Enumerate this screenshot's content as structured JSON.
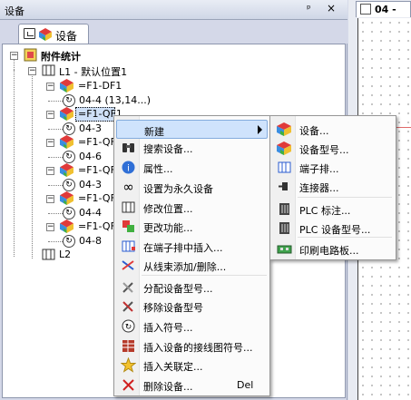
{
  "panel": {
    "title": "设备",
    "pin": "ᵖ",
    "close": "×"
  },
  "tab": {
    "label": "设备"
  },
  "doc_tab": {
    "label": "04 -"
  },
  "tree": {
    "root": "附件统计",
    "location": "L1 - 默认位置1",
    "items": [
      {
        "device": "=F1-DF1",
        "child": "04-4 (13,14...)"
      },
      {
        "device": "=F1-QF1",
        "child": "04-3"
      },
      {
        "device": "=F1-QF2",
        "child": "04-6"
      },
      {
        "device": "=F1-QF3",
        "child": "04-3"
      },
      {
        "device": "=F1-QF4",
        "child": "04-4"
      },
      {
        "device": "=F1-QF5",
        "child": "04-8"
      }
    ],
    "location2": "L2"
  },
  "context_menu": {
    "items": [
      {
        "label": "新建",
        "icon": "blank",
        "submenu": true
      },
      {
        "label": "搜索设备...",
        "icon": "binoculars-icon"
      },
      {
        "label": "属性...",
        "icon": "info-icon"
      },
      {
        "label": "设置为永久设备",
        "icon": "infinity-icon"
      },
      {
        "label": "修改位置...",
        "icon": "location-icon"
      },
      {
        "label": "更改功能...",
        "icon": "function-icon"
      },
      {
        "label": "在端子排中插入...",
        "icon": "terminal-insert-icon"
      },
      {
        "label": "从线束添加/删除...",
        "icon": "harness-icon"
      },
      {
        "label": "分配设备型号...",
        "icon": "assign-tools-icon"
      },
      {
        "label": "移除设备型号",
        "icon": "remove-tools-icon"
      },
      {
        "label": "插入符号...",
        "icon": "symbol-icon"
      },
      {
        "label": "插入设备的接线图符号...",
        "icon": "wiring-icon"
      },
      {
        "label": "插入关联定...",
        "icon": "star-icon"
      },
      {
        "label": "删除设备...",
        "icon": "delete-icon",
        "shortcut": "Del"
      }
    ]
  },
  "submenu": {
    "items": [
      {
        "label": "设备...",
        "icon": "device-cube-icon"
      },
      {
        "label": "设备型号...",
        "icon": "device-model-icon"
      },
      {
        "label": "端子排...",
        "icon": "terminal-strip-icon"
      },
      {
        "label": "连接器...",
        "icon": "connector-icon"
      },
      {
        "label": "PLC 标注...",
        "icon": "plc-icon"
      },
      {
        "label": "PLC 设备型号...",
        "icon": "plc-model-icon"
      },
      {
        "label": "印刷电路板...",
        "icon": "pcb-icon"
      }
    ]
  },
  "colors": {
    "highlight": "#cfe3fc",
    "highlight_border": "#84acdd"
  }
}
